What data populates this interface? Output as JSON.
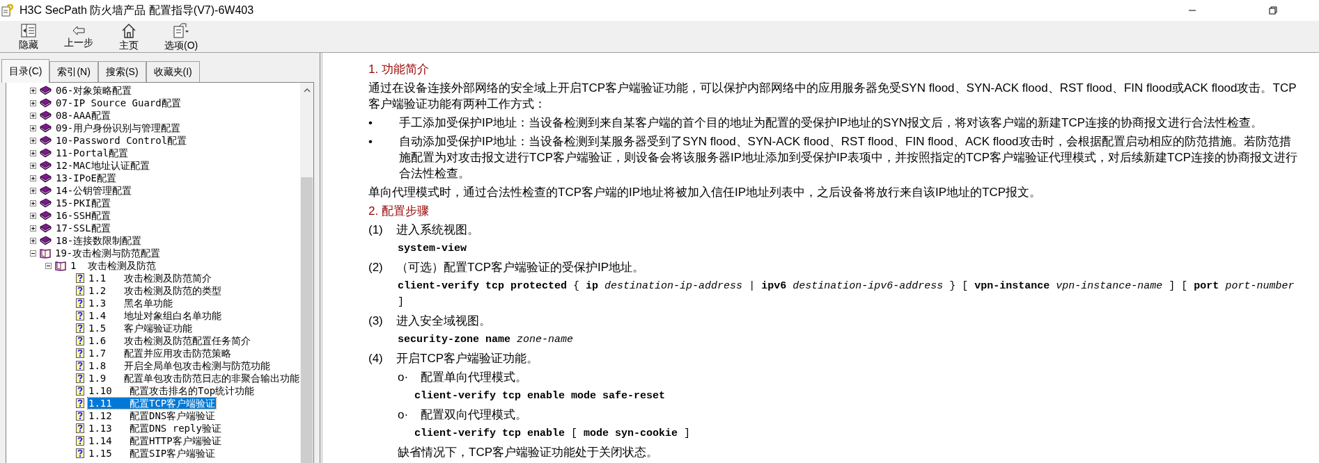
{
  "window": {
    "title": "H3C SecPath 防火墙产品 配置指导(V7)-6W403"
  },
  "toolbar": [
    {
      "kind": "hide",
      "label": "隐藏"
    },
    {
      "kind": "back",
      "label": "上一步"
    },
    {
      "kind": "home",
      "label": "主页"
    },
    {
      "kind": "options",
      "label": "选项(O)"
    }
  ],
  "tabs": [
    {
      "label": "目录(C)",
      "selected": true
    },
    {
      "label": "索引(N)",
      "selected": false
    },
    {
      "label": "搜索(S)",
      "selected": false
    },
    {
      "label": "收藏夹(I)",
      "selected": false
    }
  ],
  "tree": [
    {
      "label": "06-对象策略配置",
      "expanded": false,
      "selected": false
    },
    {
      "label": "07-IP Source Guard配置",
      "expanded": false,
      "selected": false
    },
    {
      "label": "08-AAA配置",
      "expanded": false,
      "selected": false
    },
    {
      "label": "09-用户身份识别与管理配置",
      "expanded": false,
      "selected": false
    },
    {
      "label": "10-Password Control配置",
      "expanded": false,
      "selected": false
    },
    {
      "label": "11-Portal配置",
      "expanded": false,
      "selected": false
    },
    {
      "label": "12-MAC地址认证配置",
      "expanded": false,
      "selected": false
    },
    {
      "label": "13-IPoE配置",
      "expanded": false,
      "selected": false
    },
    {
      "label": "14-公钥管理配置",
      "expanded": false,
      "selected": false
    },
    {
      "label": "15-PKI配置",
      "expanded": false,
      "selected": false
    },
    {
      "label": "16-SSH配置",
      "expanded": false,
      "selected": false
    },
    {
      "label": "17-SSL配置",
      "expanded": false,
      "selected": false
    },
    {
      "label": "18-连接数限制配置",
      "expanded": false,
      "selected": false
    },
    {
      "label": "19-攻击检测与防范配置",
      "expanded": true,
      "selected": false,
      "children": [
        {
          "label": "1  攻击检测及防范",
          "expanded": true,
          "selected": false,
          "children": [
            {
              "label": "1.1   攻击检测及防范简介",
              "selected": false
            },
            {
              "label": "1.2   攻击检测及防范的类型",
              "selected": false
            },
            {
              "label": "1.3   黑名单功能",
              "selected": false
            },
            {
              "label": "1.4   地址对象组白名单功能",
              "selected": false
            },
            {
              "label": "1.5   客户端验证功能",
              "selected": false
            },
            {
              "label": "1.6   攻击检测及防范配置任务简介",
              "selected": false
            },
            {
              "label": "1.7   配置并应用攻击防范策略",
              "selected": false
            },
            {
              "label": "1.8   开启全局单包攻击检测与防范功能",
              "selected": false
            },
            {
              "label": "1.9   配置单包攻击防范日志的非聚合输出功能",
              "selected": false
            },
            {
              "label": "1.10   配置攻击排名的Top统计功能",
              "selected": false
            },
            {
              "label": "1.11   配置TCP客户端验证",
              "selected": true
            },
            {
              "label": "1.12   配置DNS客户端验证",
              "selected": false
            },
            {
              "label": "1.13   配置DNS reply验证",
              "selected": false
            },
            {
              "label": "1.14   配置HTTP客户端验证",
              "selected": false
            },
            {
              "label": "1.15   配置SIP客户端验证",
              "selected": false
            }
          ]
        }
      ]
    }
  ],
  "content": [
    {
      "kind": "heading",
      "text": "1. 功能简介"
    },
    {
      "kind": "para",
      "text": "通过在设备连接外部网络的安全域上开启TCP客户端验证功能，可以保护内部网络中的应用服务器免受SYN flood、SYN-ACK flood、RST flood、FIN flood或ACK flood攻击。TCP客户端验证功能有两种工作方式："
    },
    {
      "kind": "bullet",
      "marker": "•",
      "text": "手工添加受保护IP地址：当设备检测到来自某客户端的首个目的地址为配置的受保护IP地址的SYN报文后，将对该客户端的新建TCP连接的协商报文进行合法性检查。"
    },
    {
      "kind": "bullet",
      "marker": "•",
      "text": "自动添加受保护IP地址：当设备检测到某服务器受到了SYN flood、SYN-ACK flood、RST flood、FIN flood、ACK flood攻击时，会根据配置启动相应的防范措施。若防范措施配置为对攻击报文进行TCP客户端验证，则设备会将该服务器IP地址添加到受保护IP表项中，并按照指定的TCP客户端验证代理模式，对后续新建TCP连接的协商报文进行合法性检查。"
    },
    {
      "kind": "para",
      "text": "单向代理模式时，通过合法性检查的TCP客户端的IP地址将被加入信任IP地址列表中，之后设备将放行来自该IP地址的TCP报文。"
    },
    {
      "kind": "heading",
      "text": "2. 配置步骤"
    },
    {
      "kind": "step",
      "marker": "(1)",
      "text": "进入系统视图。"
    },
    {
      "kind": "command",
      "text": "**system-view**"
    },
    {
      "kind": "step",
      "marker": "(2)",
      "text": "（可选）配置TCP客户端验证的受保护IP地址。"
    },
    {
      "kind": "command",
      "text": "**client-verify tcp protected** { **ip** *destination-ip-address* | **ipv6** *destination-ipv6-address* } [ **vpn-instance** *vpn-instance-name* ] [ **port** *port-number* ]"
    },
    {
      "kind": "step",
      "marker": "(3)",
      "text": "进入安全域视图。"
    },
    {
      "kind": "command",
      "text": "**security-zone name** *zone-name*"
    },
    {
      "kind": "step",
      "marker": "(4)",
      "text": "开启TCP客户端验证功能。"
    },
    {
      "kind": "subbullet",
      "marker": "o·",
      "text": "配置单向代理模式。"
    },
    {
      "kind": "subcommand",
      "text": "**client-verify tcp enable mode safe-reset**"
    },
    {
      "kind": "subbullet",
      "marker": "o·",
      "text": "配置双向代理模式。"
    },
    {
      "kind": "subcommand",
      "text": "**client-verify tcp enable** [ **mode syn-cookie** ]"
    },
    {
      "kind": "note",
      "text": "缺省情况下，TCP客户端验证功能处于关闭状态。"
    }
  ]
}
